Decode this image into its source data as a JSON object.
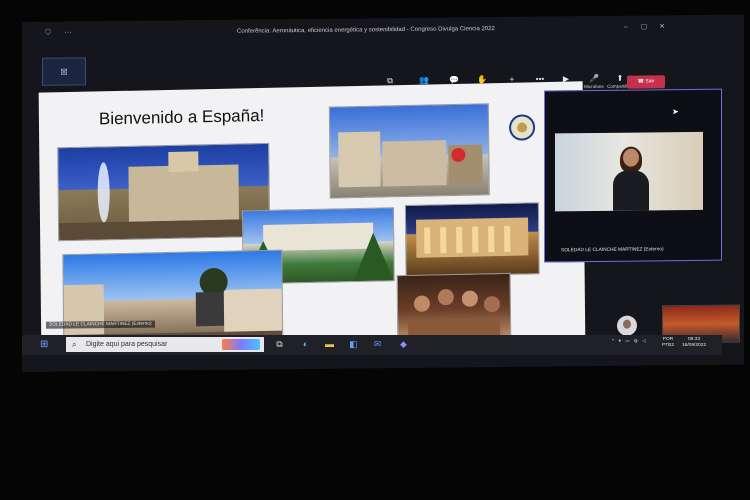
{
  "window": {
    "title": "Conferência: Aeronáutica, eficiencia energética y sostenibilidad - Congreso Divulga Ciencia 2022"
  },
  "toolbar": {
    "items": [
      {
        "label": "Nova janela",
        "icon": "window-icon"
      },
      {
        "label": "Pessoas",
        "icon": "people-icon"
      },
      {
        "label": "Chat",
        "icon": "chat-icon"
      },
      {
        "label": "Reações",
        "icon": "reactions-icon"
      },
      {
        "label": "Aplicativos",
        "icon": "plus-icon"
      },
      {
        "label": "Mais",
        "icon": "more-icon"
      },
      {
        "label": "Câmera",
        "icon": "camera-icon"
      },
      {
        "label": "Microfone",
        "icon": "microphone-icon"
      },
      {
        "label": "Compartilhar",
        "icon": "share-icon"
      }
    ],
    "leave_label": "Sair"
  },
  "slide": {
    "title": "Bienvenido a España!"
  },
  "speaker": {
    "name": "SOLEDAD LE CLAINCHE MARTINEZ (Externo)",
    "overlay_name": "SOLEDAD LE CLAINCHE MARTINEZ (Externo)"
  },
  "taskbar": {
    "search_placeholder": "Digite aqui para pesquisar",
    "lang_top": "POR",
    "lang_bottom": "PTB2",
    "time": "09:33",
    "date": "16/09/2022"
  }
}
